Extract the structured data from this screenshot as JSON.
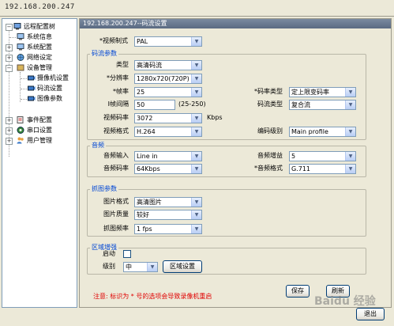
{
  "window": {
    "title": "192.168.200.247"
  },
  "tree": {
    "root": "远程配置树",
    "items": [
      "系统信息",
      "系统配置",
      "网络设定",
      "设备管理",
      "摄像机设置",
      "码流设置",
      "图像参数",
      "事件配置",
      "串口设置",
      "用户管理"
    ]
  },
  "panel": {
    "header": "192.168.200.247--码流设置",
    "video_standard": {
      "label": "*视频制式",
      "value": "PAL"
    },
    "stream": {
      "title": "码流参数",
      "type": {
        "label": "类型",
        "value": "高清码流"
      },
      "resolution": {
        "label": "*分辨率",
        "value": "1280x720(720P)"
      },
      "framerate": {
        "label": "*帧率",
        "value": "25"
      },
      "bitrate_type": {
        "label": "*码率类型",
        "value": "定上限变码率"
      },
      "iframe": {
        "label": "I帧间隔",
        "value": "50",
        "hint": "(25-250)"
      },
      "stream_type": {
        "label": "码流类型",
        "value": "复合流"
      },
      "bitrate": {
        "label": "视频码率",
        "value": "3072",
        "unit": "Kbps"
      },
      "video_format": {
        "label": "视频格式",
        "value": "H.264"
      },
      "profile": {
        "label": "编码级别",
        "value": "Main profile"
      }
    },
    "audio": {
      "title": "音频",
      "input": {
        "label": "音频输入",
        "value": "Line in"
      },
      "gain": {
        "label": "音频增益",
        "value": "5"
      },
      "bitrate": {
        "label": "音频码率",
        "value": "64Kbps"
      },
      "format": {
        "label": "*音频格式",
        "value": "G.711"
      }
    },
    "snapshot": {
      "title": "抓图参数",
      "format": {
        "label": "图片格式",
        "value": "高清图片"
      },
      "quality": {
        "label": "图片质量",
        "value": "较好"
      },
      "rate": {
        "label": "抓图频率",
        "value": "1 fps"
      }
    },
    "roi": {
      "title": "区域增强",
      "enable": {
        "label": "启动",
        "checked": false
      },
      "level": {
        "label": "级别",
        "value": "中"
      },
      "button": "区域设置"
    },
    "note": "注意: 标识为 * 号的选项会导致录像机重启",
    "save": "保存",
    "refresh": "刷新",
    "exit": "退出"
  },
  "watermark": "Baidu 经验"
}
